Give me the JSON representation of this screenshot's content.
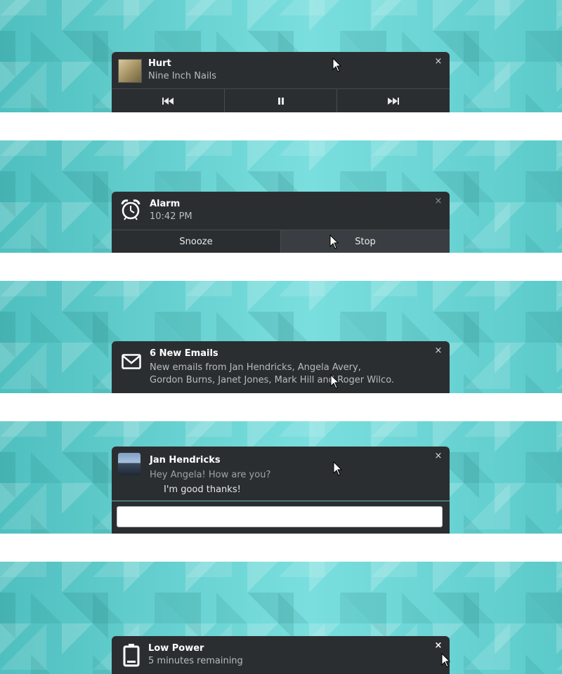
{
  "music": {
    "track_title": "Hurt",
    "artist": "Nine Inch Nails",
    "controls": {
      "previous": "previous-track",
      "pause": "pause",
      "next": "next-track"
    }
  },
  "alarm": {
    "title": "Alarm",
    "time": "10:42 PM",
    "snooze_label": "Snooze",
    "stop_label": "Stop"
  },
  "email": {
    "title": "6 New Emails",
    "body": "New emails from Jan Hendricks, Angela Avery, Gordon Burns, Janet Jones, Mark Hill and Roger Wilco."
  },
  "chat": {
    "sender": "Jan Hendricks",
    "incoming_message": "Hey Angela! How are you?",
    "outgoing_message": "I'm good thanks!",
    "reply_value": ""
  },
  "battery": {
    "title": "Low Power",
    "subtitle": "5 minutes remaining"
  },
  "common": {
    "close_glyph": "×"
  },
  "colors": {
    "notification_bg": "#2b2e31",
    "wallpaper": "#5cc9c9",
    "secondary_text": "#b7bcbf",
    "reply_border": "#5fb9b9"
  }
}
